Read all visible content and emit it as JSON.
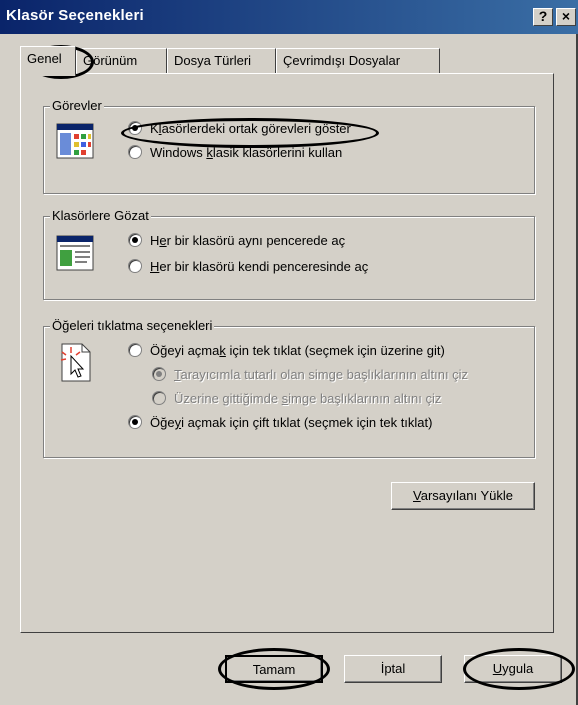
{
  "window": {
    "title": "Klasör Seçenekleri",
    "help_btn": "?",
    "close_btn": "×"
  },
  "tabs": [
    {
      "label": "Genel"
    },
    {
      "label": "Görünüm"
    },
    {
      "label": "Dosya Türleri"
    },
    {
      "label": "Çevrimdışı Dosyalar"
    }
  ],
  "groups": {
    "tasks": {
      "label": "Görevler",
      "options": [
        {
          "pre": "K",
          "ul": "l",
          "post": "asörlerdeki ortak görevleri göster",
          "selected": true
        },
        {
          "pre": "Windows ",
          "ul": "k",
          "post": "lasik klasörlerini kullan",
          "selected": false
        }
      ]
    },
    "browse": {
      "label": "Klasörlere Gözat",
      "options": [
        {
          "pre": "H",
          "ul": "e",
          "post": "r bir klasörü aynı pencerede aç",
          "selected": true
        },
        {
          "pre": "",
          "ul": "H",
          "post": "er bir klasörü kendi penceresinde aç",
          "selected": false
        }
      ]
    },
    "click": {
      "label": "Öğeleri tıklatma seçenekleri",
      "options": [
        {
          "pre": "Öğeyi açma",
          "ul": "k",
          "post": " için tek tıklat (seçmek için üzerine git)",
          "selected": false
        },
        {
          "pre": "",
          "ul": "T",
          "post": "arayıcımla tutarlı olan simge başlıklarının altını çiz",
          "selected": true,
          "disabled": true
        },
        {
          "pre": "Üzerine gittiğimde ",
          "ul": "s",
          "post": "imge başlıklarının altını çiz",
          "selected": false,
          "disabled": true
        },
        {
          "pre": "Öğe",
          "ul": "y",
          "post": "i açmak için çift tıklat (seçmek için tek tıklat)",
          "selected": true
        }
      ]
    }
  },
  "restore_defaults": {
    "ul": "V",
    "post": "arsayılanı Yükle"
  },
  "buttons": {
    "ok": "Tamam",
    "cancel": "İptal",
    "apply_ul": "U",
    "apply_post": "ygula"
  }
}
